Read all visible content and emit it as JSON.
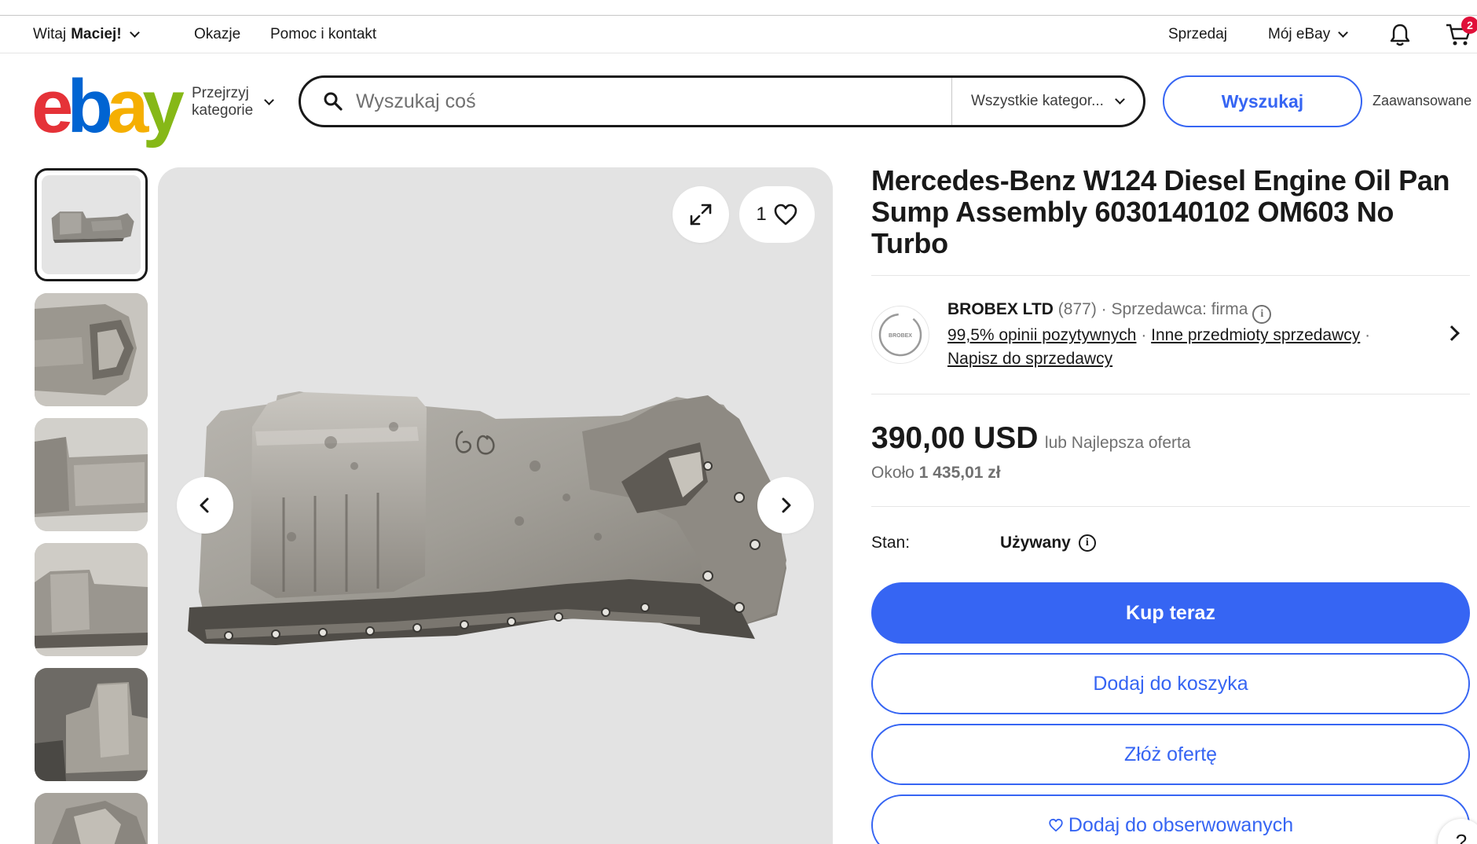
{
  "topbar": {
    "greeting": "Witaj",
    "user": "Maciej!",
    "links": [
      "Okazje",
      "Pomoc i kontakt"
    ],
    "sell": "Sprzedaj",
    "my_ebay": "Mój eBay",
    "cart_count": "2"
  },
  "header": {
    "logo_letters": [
      "e",
      "b",
      "a",
      "y"
    ],
    "logo_colors": [
      "#e53238",
      "#0064d2",
      "#f5af02",
      "#86b817"
    ],
    "browse_line1": "Przejrzyj",
    "browse_line2": "kategorie",
    "search_placeholder": "Wyszukaj coś",
    "category": "Wszystkie kategor...",
    "search_button": "Wyszukaj",
    "advanced": "Zaawansowane"
  },
  "gallery": {
    "watch_count": "1",
    "thumbnail_count": 6,
    "active_thumbnail": 1
  },
  "listing": {
    "title": "Mercedes-Benz W124 Diesel Engine Oil Pan Sump Assembly 6030140102 OM603 No Turbo",
    "seller": {
      "name": "BROBEX LTD",
      "feedback_count": "(877)",
      "separator": "·",
      "type": "Sprzedawca: firma",
      "positive": "99,5% opinii pozytywnych",
      "other_items": "Inne przedmioty sprzedawcy",
      "contact": "Napisz do sprzedawcy",
      "avatar_text": "BROBEX"
    },
    "price": "390,00 USD",
    "price_note": "lub Najlepsza oferta",
    "approx_label": "Około",
    "approx_value": "1 435,01 zł",
    "condition_label": "Stan:",
    "condition_value": "Używany",
    "buttons": {
      "buy_now": "Kup teraz",
      "add_to_cart": "Dodaj do koszyka",
      "make_offer": "Złóż ofertę",
      "watch": "Dodaj do obserwowanych"
    }
  },
  "help": "?"
}
